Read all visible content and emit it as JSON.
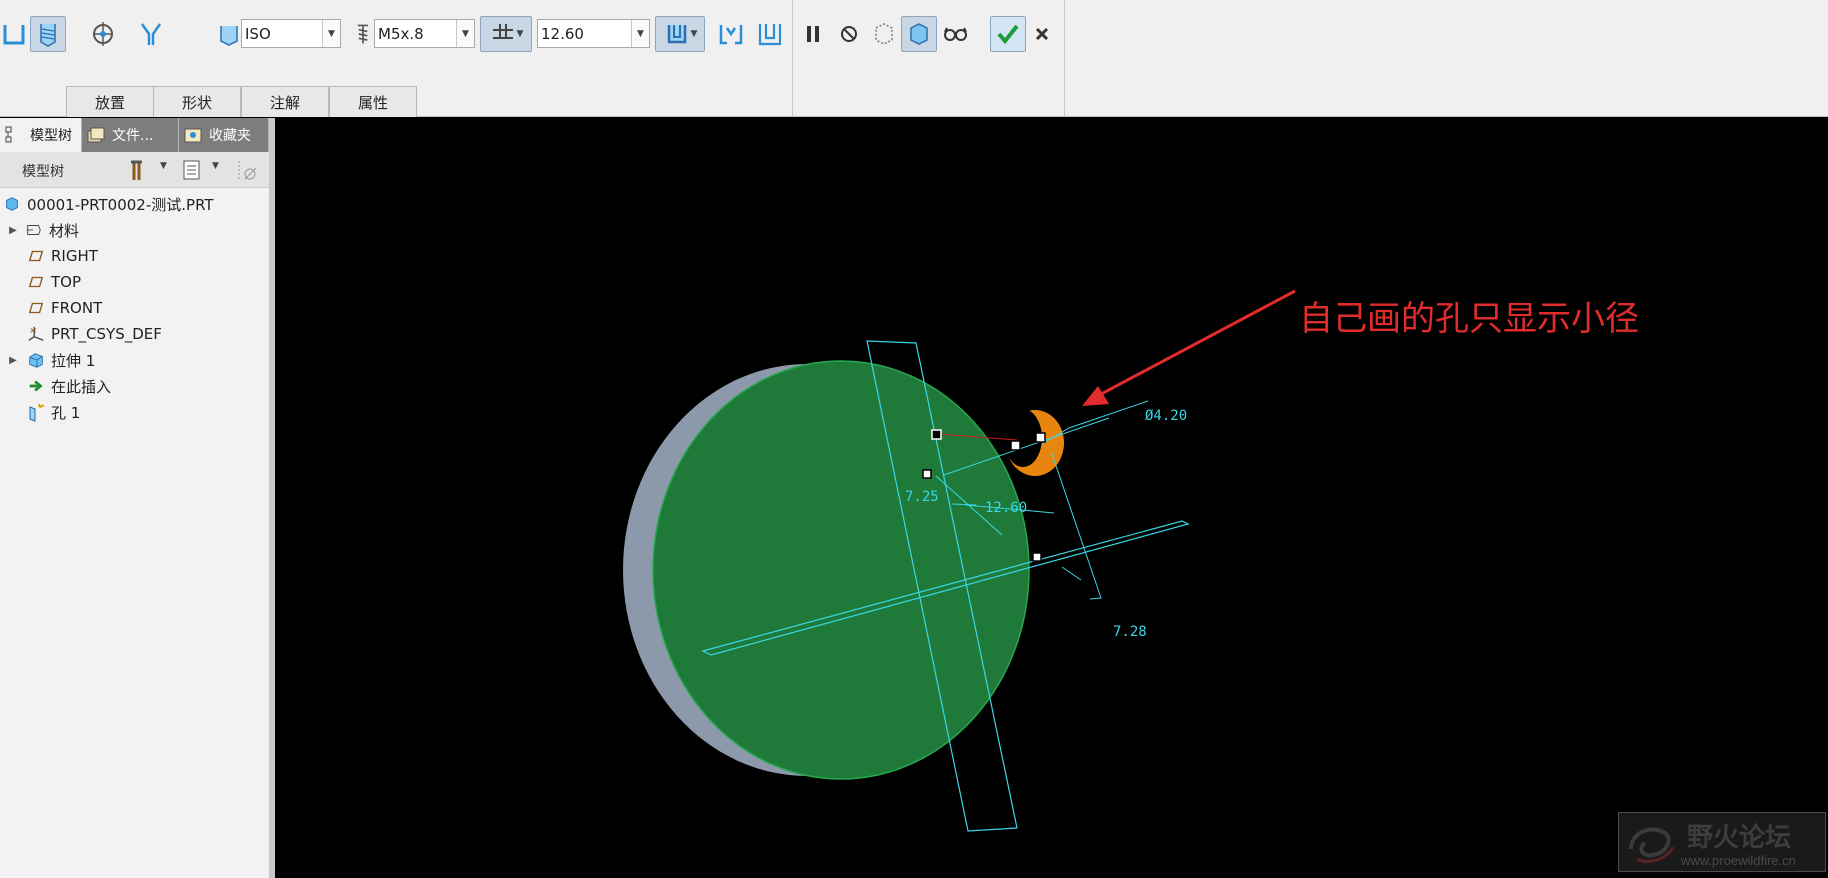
{
  "toolbar": {
    "standard": "ISO",
    "screw_size": "M5x.8",
    "depth_value": "12.60",
    "dashboard_tabs": [
      "放置",
      "形状",
      "注解",
      "属性"
    ]
  },
  "panel": {
    "tabs": [
      "模型树",
      "文件...",
      "收藏夹"
    ],
    "tree_title": "模型树",
    "tree_items": [
      {
        "label": "00001-PRT0002-测试.PRT",
        "icon": "part-icon",
        "expand": ""
      },
      {
        "label": "材料",
        "icon": "material-icon",
        "expand": "▶"
      },
      {
        "label": "RIGHT",
        "icon": "datum-plane-icon",
        "expand": ""
      },
      {
        "label": "TOP",
        "icon": "datum-plane-icon",
        "expand": ""
      },
      {
        "label": "FRONT",
        "icon": "datum-plane-icon",
        "expand": ""
      },
      {
        "label": "PRT_CSYS_DEF",
        "icon": "csys-icon",
        "expand": ""
      },
      {
        "label": "拉伸 1",
        "icon": "extrude-icon",
        "expand": "▶"
      },
      {
        "label": "在此插入",
        "icon": "insert-here-icon",
        "expand": ""
      },
      {
        "label": "孔 1",
        "icon": "hole-icon",
        "expand": ""
      }
    ]
  },
  "viewport": {
    "annotation": "自己画的孔只显示小径",
    "dimensions": {
      "diameter": "Ø4.20",
      "dim_a": "7.25",
      "dim_b": "12.60",
      "dim_c": "7.28"
    },
    "colors": {
      "background": "#000000",
      "face": "#1f7a3a",
      "datum": "#3ad7e6",
      "hole": "#e88a10",
      "annotation": "#e22c2c"
    }
  },
  "watermark": {
    "title": "野火论坛",
    "url": "www.proewildfire.cn"
  }
}
